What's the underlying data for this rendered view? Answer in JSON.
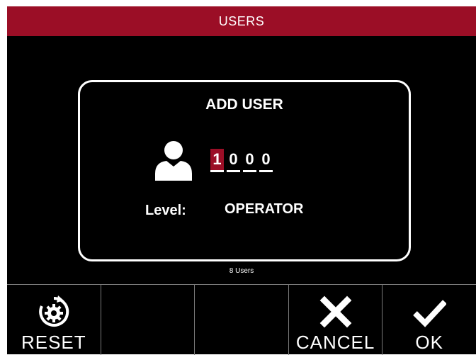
{
  "header": {
    "title": "USERS"
  },
  "dialog": {
    "title": "ADD USER",
    "user_id_digits": [
      "1",
      "0",
      "0",
      "0"
    ],
    "level_label": "Level:",
    "level_value": "OPERATOR"
  },
  "status": {
    "user_count": "8 Users"
  },
  "bottom_bar": {
    "reset_label": "RESET",
    "cancel_label": "CANCEL",
    "ok_label": "OK"
  },
  "colors": {
    "accent": "#9b0e26",
    "background": "#000000",
    "foreground": "#ffffff"
  },
  "icons": [
    "user-icon",
    "reset-icon",
    "cancel-icon",
    "ok-icon"
  ]
}
